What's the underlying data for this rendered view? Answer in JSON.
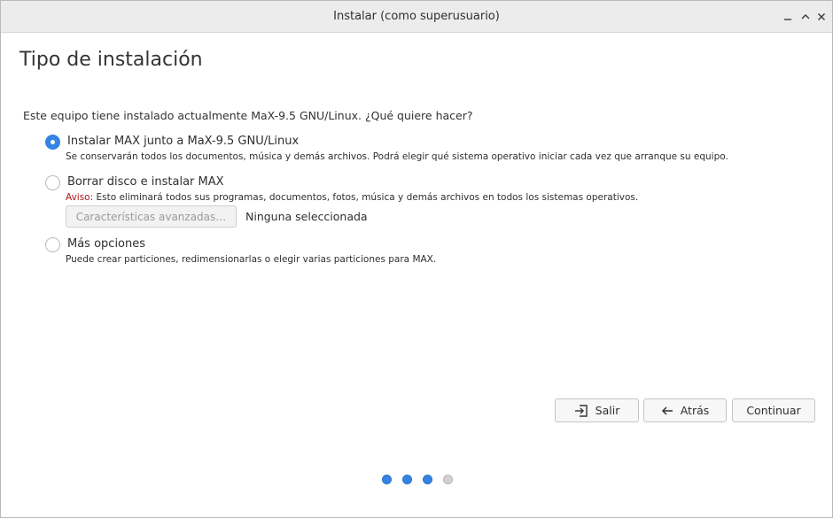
{
  "window": {
    "title": "Instalar (como superusuario)"
  },
  "page": {
    "heading": "Tipo de instalación",
    "question": "Este equipo tiene instalado actualmente MaX-9.5 GNU/Linux. ¿Qué quiere hacer?"
  },
  "options": [
    {
      "label": "Instalar MAX junto a MaX-9.5 GNU/Linux",
      "description": "Se conservarán todos los documentos, música y demás archivos. Podrá elegir qué sistema operativo iniciar cada vez que arranque su equipo.",
      "selected": true
    },
    {
      "label": "Borrar disco e instalar MAX",
      "warning_prefix": "Aviso:",
      "description": " Esto eliminará todos sus programas, documentos, fotos, música y demás archivos en todos los sistemas operativos.",
      "selected": false
    },
    {
      "label": "Más opciones",
      "description": "Puede crear particiones, redimensionarlas o elegir varias particiones para MAX.",
      "selected": false
    }
  ],
  "advanced": {
    "button_label": "Características avanzadas…",
    "status": "Ninguna seleccionada"
  },
  "buttons": {
    "quit": "Salir",
    "back": "Atrás",
    "continue": "Continuar"
  },
  "progress": {
    "total_steps": 4,
    "completed_steps": 3
  },
  "colors": {
    "accent": "#3584e4",
    "warning": "#b01515"
  }
}
